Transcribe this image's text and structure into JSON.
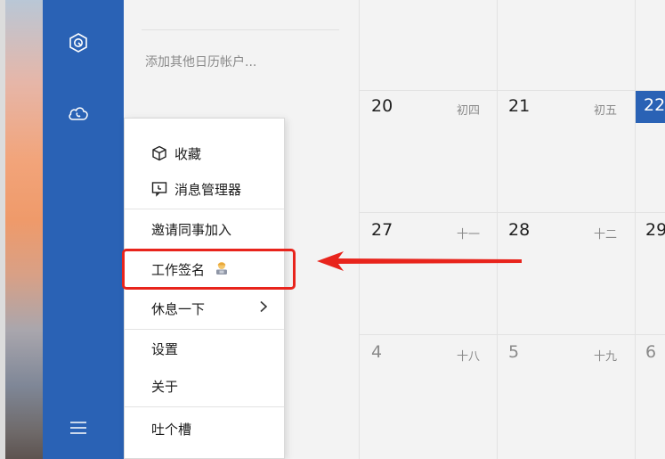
{
  "sidebar": {
    "add_account_label": "添加其他日历帐户..."
  },
  "calendar": {
    "rows": [
      {
        "cells": [
          {
            "day": "20",
            "lunar": "初四"
          },
          {
            "day": "21",
            "lunar": "初五"
          },
          {
            "day": "22",
            "lunar": ""
          }
        ]
      },
      {
        "cells": [
          {
            "day": "27",
            "lunar": "十一"
          },
          {
            "day": "28",
            "lunar": "十二"
          },
          {
            "day": "29",
            "lunar": ""
          }
        ]
      },
      {
        "cells": [
          {
            "day": "4",
            "lunar": "十八"
          },
          {
            "day": "5",
            "lunar": "十九"
          },
          {
            "day": "6",
            "lunar": ""
          }
        ]
      }
    ]
  },
  "menu": {
    "favorites": "收藏",
    "message_manager": "消息管理器",
    "invite_colleague": "邀请同事加入",
    "work_signature": "工作签名",
    "take_a_break": "休息一下",
    "settings": "设置",
    "about": "关于",
    "feedback": "吐个槽"
  },
  "colors": {
    "rail": "#2a62b5",
    "today": "#2a62b5",
    "annotation": "#e8241c"
  },
  "icons": {
    "rail_top": "hexagon-logo-icon",
    "rail_second": "cloud-phone-icon",
    "rail_bottom": "hamburger-menu-icon",
    "favorites": "cube-icon",
    "message_manager": "chat-box-icon",
    "work_signature": "office-worker-emoji",
    "take_a_break": "chevron-right-icon"
  }
}
